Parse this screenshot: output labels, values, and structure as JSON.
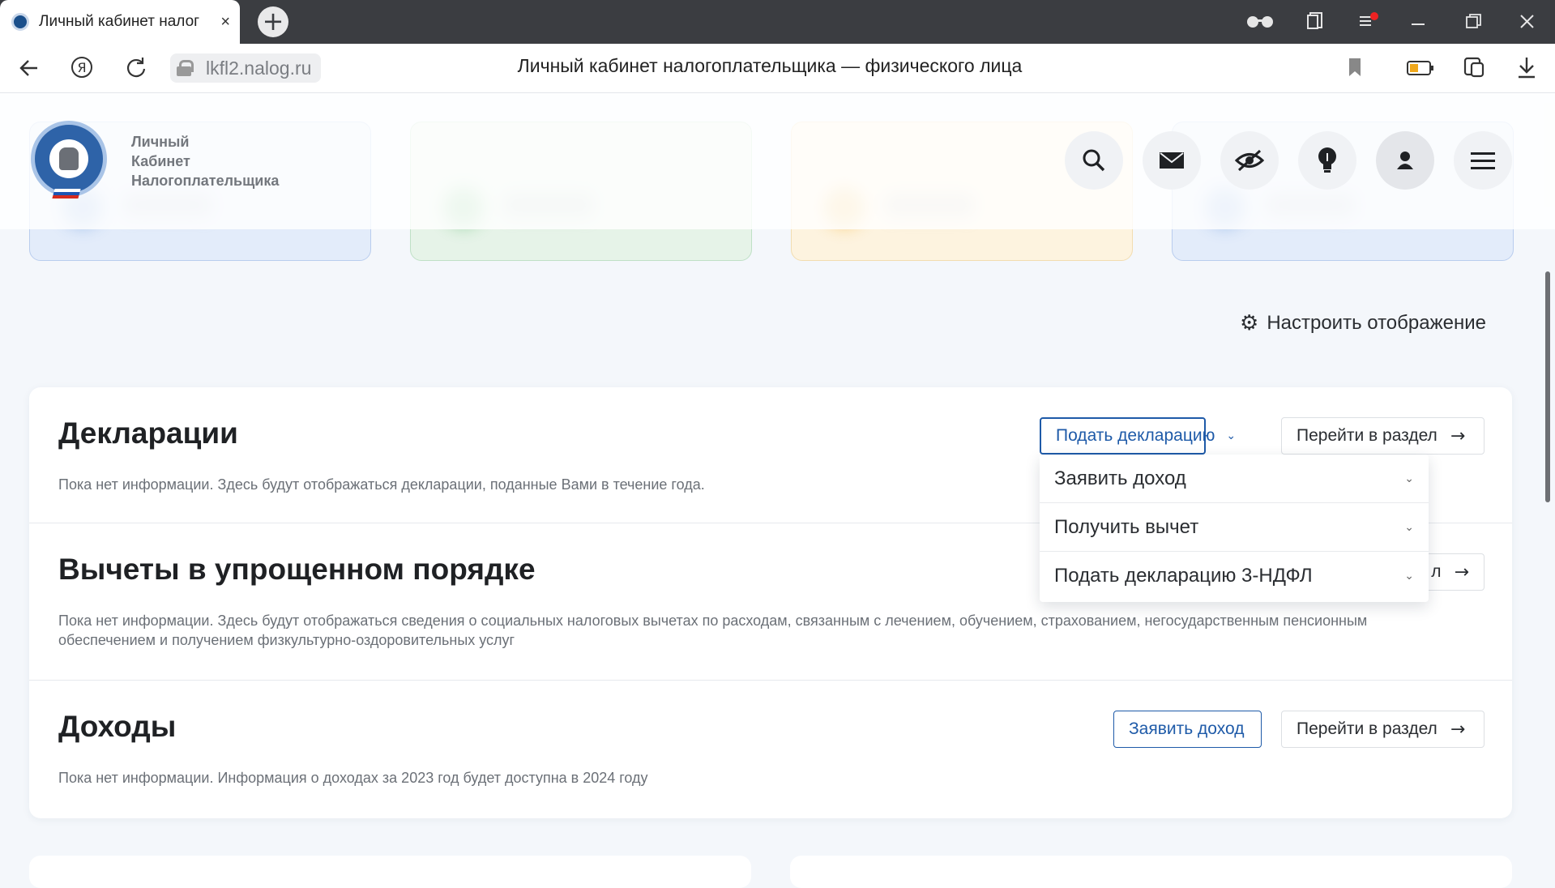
{
  "browser": {
    "tab_title": "Личный кабинет налог",
    "tab_close": "×",
    "new_tab": "+",
    "url": "lkfl2.nalog.ru",
    "page_heading": "Личный кабинет налогоплательщика — физического лица"
  },
  "header": {
    "logo_lines": [
      "Личный",
      "Кабинет",
      "Налогоплательщика"
    ],
    "icons": [
      "search-icon",
      "mail-icon",
      "visibility-off-icon",
      "lightbulb-icon",
      "user-icon",
      "menu-icon"
    ]
  },
  "settings": {
    "label": "Настроить отображение"
  },
  "sections": [
    {
      "title": "Декларации",
      "desc": "Пока нет информации. Здесь будут отображаться декларации, поданные Вами в течение года.",
      "primary_button": "Подать декларацию",
      "goto_button": "Перейти в раздел"
    },
    {
      "title": "Вычеты в упрощенном порядке",
      "desc": "Пока нет информации. Здесь будут отображаться сведения о социальных налоговых вычетах по расходам, связанным с лечением, обучением, страхованием, негосударственным пенсионным обеспечением и получением физкультурно-оздоровительных услуг",
      "goto_button_partial": "л"
    },
    {
      "title": "Доходы",
      "desc": "Пока нет информации. Информация о доходах за 2023 год будет доступна в 2024 году",
      "primary_button": "Заявить доход",
      "goto_button": "Перейти в раздел"
    }
  ],
  "dropdown": {
    "items": [
      "Заявить доход",
      "Получить вычет",
      "Подать декларацию 3-НДФЛ"
    ]
  },
  "colors": {
    "accent": "#1e5aa8",
    "tile_blue": "#e3ecfa",
    "tile_green": "#e6f3e8",
    "tile_yellow": "#fdf3df"
  }
}
